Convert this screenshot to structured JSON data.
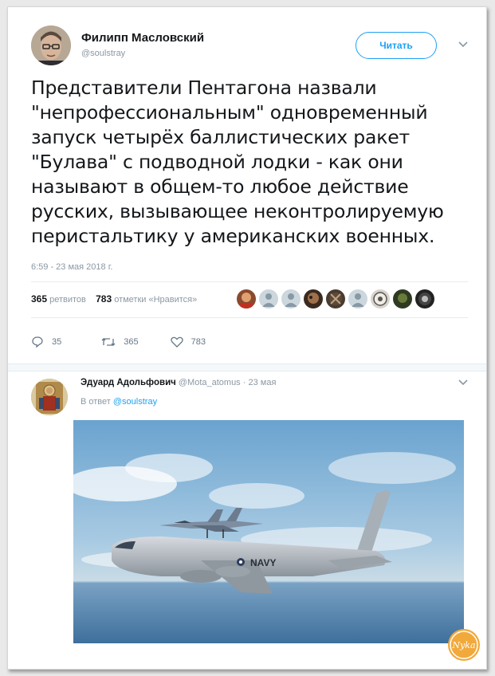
{
  "tweet": {
    "author_name": "Филипп Масловский",
    "author_handle": "@soulstray",
    "follow_label": "Читать",
    "text": "Представители Пентагона назвали \"непрофессиональным\" одновременный запуск четырёх баллистических ракет \"Булава\" с подводной лодки - как они называют в общем-то любое действие русских, вызывающее неконтролируемую перистальтику у американских военных.",
    "timestamp": "6:59 - 23 мая 2018 г.",
    "retweets_count": "365",
    "retweets_label": "ретвитов",
    "likes_count": "783",
    "likes_label": "отметки «Нравится»",
    "actions": {
      "reply_count": "35",
      "retweet_count": "365",
      "like_count": "783"
    }
  },
  "reply": {
    "author_name": "Эдуард Адольфович",
    "author_handle": "@Mota_atomus",
    "date": "· 23 мая",
    "reply_to_label": "В ответ",
    "reply_to_handle": "@soulstray",
    "image_text": "NAVY"
  },
  "colors": {
    "accent": "#1da1f2",
    "text": "#14171a",
    "muted": "#8b98a3"
  },
  "icons": {
    "reply": "reply-icon",
    "retweet": "retweet-icon",
    "like": "heart-icon",
    "caret": "chevron-down-icon",
    "watermark": "logo-icon"
  },
  "watermark_text": "Nyka"
}
